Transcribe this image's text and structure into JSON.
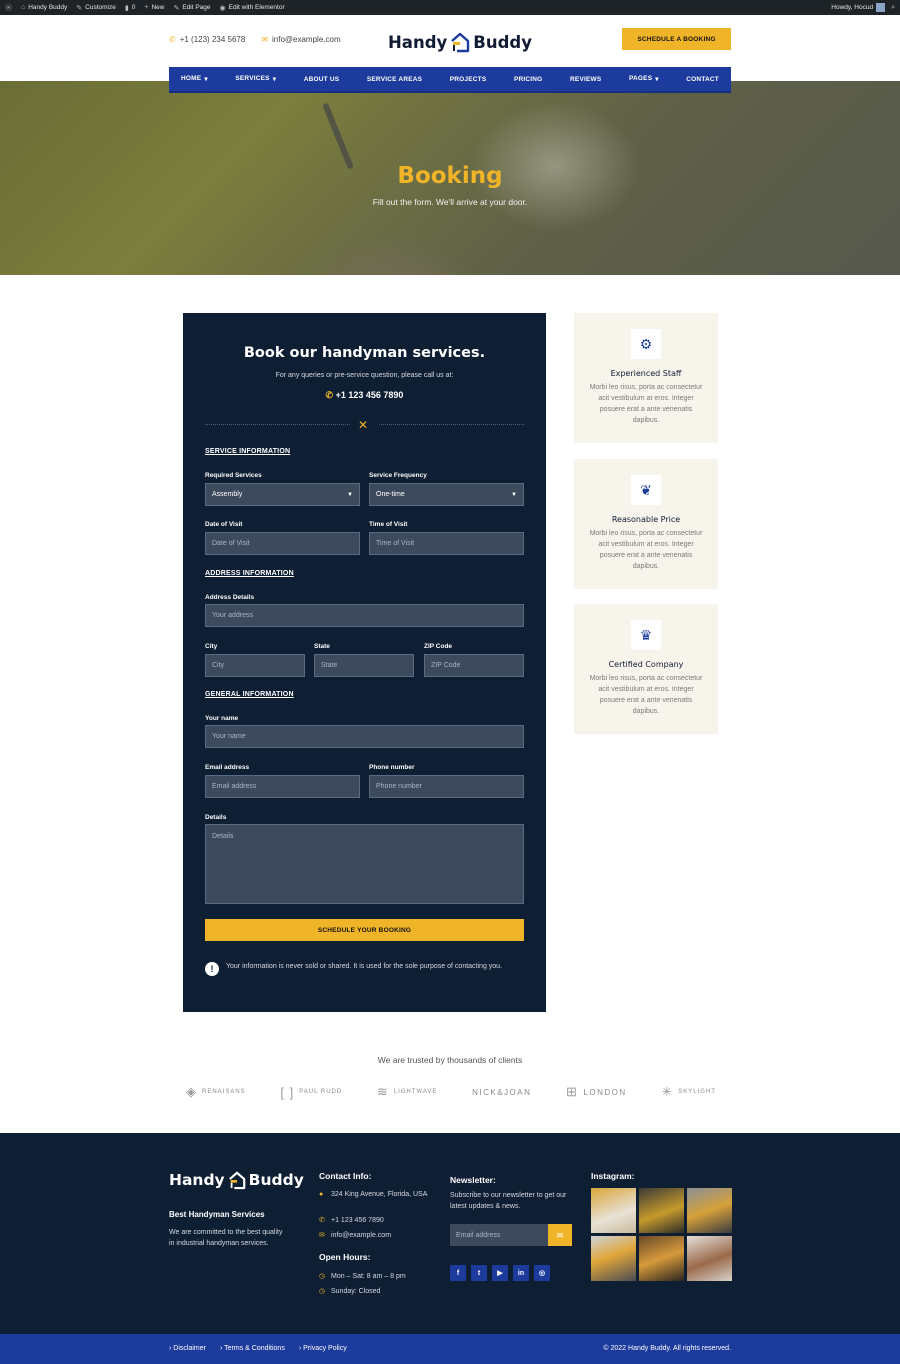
{
  "admin_bar": {
    "site": "Handy Buddy",
    "customize": "Customize",
    "comments": "0",
    "new": "New",
    "edit_page": "Edit Page",
    "elementor": "Edit with Elementor",
    "howdy": "Howdy, Hocud"
  },
  "header": {
    "phone": "+1 (123) 234 5678",
    "email": "info@example.com",
    "logo_left": "Handy",
    "logo_right": "Buddy",
    "cta": "SCHEDULE A BOOKING"
  },
  "nav": {
    "items": [
      {
        "label": "HOME",
        "dropdown": "▾"
      },
      {
        "label": "SERVICES",
        "dropdown": "▾"
      },
      {
        "label": "ABOUT US",
        "dropdown": ""
      },
      {
        "label": "SERVICE AREAS",
        "dropdown": ""
      },
      {
        "label": "PROJECTS",
        "dropdown": ""
      },
      {
        "label": "PRICING",
        "dropdown": ""
      },
      {
        "label": "REVIEWS",
        "dropdown": ""
      },
      {
        "label": "PAGES",
        "dropdown": "▾"
      },
      {
        "label": "CONTACT",
        "dropdown": ""
      }
    ]
  },
  "hero": {
    "title": "Booking",
    "subtitle": "Fill out the form. We'll arrive at your door."
  },
  "form": {
    "title": "Book our handyman services.",
    "subtitle": "For any queries or pre-service question, please call us at:",
    "phone": "+1 123 456 7890",
    "sections": {
      "service": "SERVICE INFORMATION",
      "address": "ADDRESS INFORMATION",
      "general": "GENERAL INFORMATION"
    },
    "labels": {
      "required_services": "Required Services",
      "service_frequency": "Service Frequency",
      "date_of_visit": "Date of Visit",
      "time_of_visit": "Time of Visit",
      "address_details": "Address Details",
      "city": "City",
      "state": "State",
      "zip": "ZIP Code",
      "your_name": "Your name",
      "email": "Email address",
      "phone": "Phone number",
      "details": "Details"
    },
    "values": {
      "required_services": "Assembly",
      "service_frequency": "One-time"
    },
    "placeholders": {
      "date_of_visit": "Date of Visit",
      "time_of_visit": "Time of Visit",
      "address": "Your address",
      "city": "City",
      "state": "State",
      "zip": "ZIP Code",
      "name": "Your name",
      "email": "Email address",
      "phone": "Phone number",
      "details": "Details"
    },
    "submit": "SCHEDULE YOUR BOOKING",
    "note": "Your information is never sold or shared. It is used for the sole purpose of contacting you."
  },
  "features": [
    {
      "title": "Experienced Staff",
      "text": "Morbi leo risus, porta ac consectetur acit vestibulum at eros. Integer posuere erat a ante venenatis dapibus.",
      "icon": "users-cog-icon"
    },
    {
      "title": "Reasonable Price",
      "text": "Morbi leo risus, porta ac consectetur acit vestibulum at eros. Integer posuere erat a ante venenatis dapibus.",
      "icon": "seedling-icon"
    },
    {
      "title": "Certified Company",
      "text": "Morbi leo risus, porta ac consectetur acit vestibulum at eros. Integer posuere erat a ante venenatis dapibus.",
      "icon": "crown-icon"
    }
  ],
  "trusted": {
    "heading": "We are trusted by thousands of clients",
    "brands": [
      "RENAISANS",
      "PAUL RUDD",
      "LIGHTWAVE",
      "NICK&JOAN",
      "LONDON",
      "SKYLIGHT"
    ]
  },
  "footer": {
    "logo_left": "Handy",
    "logo_right": "Buddy",
    "tagline": "Best Handyman Services",
    "description": "We are committed to the best quality in industrial handyman services.",
    "contact_heading": "Contact Info:",
    "address": "324 King Avenue, Florida, USA",
    "phone": "+1 123 456 7890",
    "email": "info@example.com",
    "hours_heading": "Open Hours:",
    "hours_weekday": "Mon – Sat: 8 am – 8 pm",
    "hours_sunday": "Sunday: Closed",
    "newsletter_heading": "Newsletter:",
    "newsletter_text": "Subscribe to our newsletter to get our latest updates & news.",
    "newsletter_placeholder": "Email address",
    "instagram_heading": "Instagram:",
    "socials": [
      "f",
      "t",
      "▶",
      "in",
      "◎"
    ]
  },
  "bottom": {
    "links": [
      "Disclaimer",
      "Terms & Conditions",
      "Privacy Policy"
    ],
    "copyright": "© 2022 Handy Buddy. All rights reserved."
  },
  "colors": {
    "navy": "#0e1e33",
    "blue": "#1d3b9c",
    "gold": "#f0b429",
    "cream": "#f7f4ec"
  }
}
